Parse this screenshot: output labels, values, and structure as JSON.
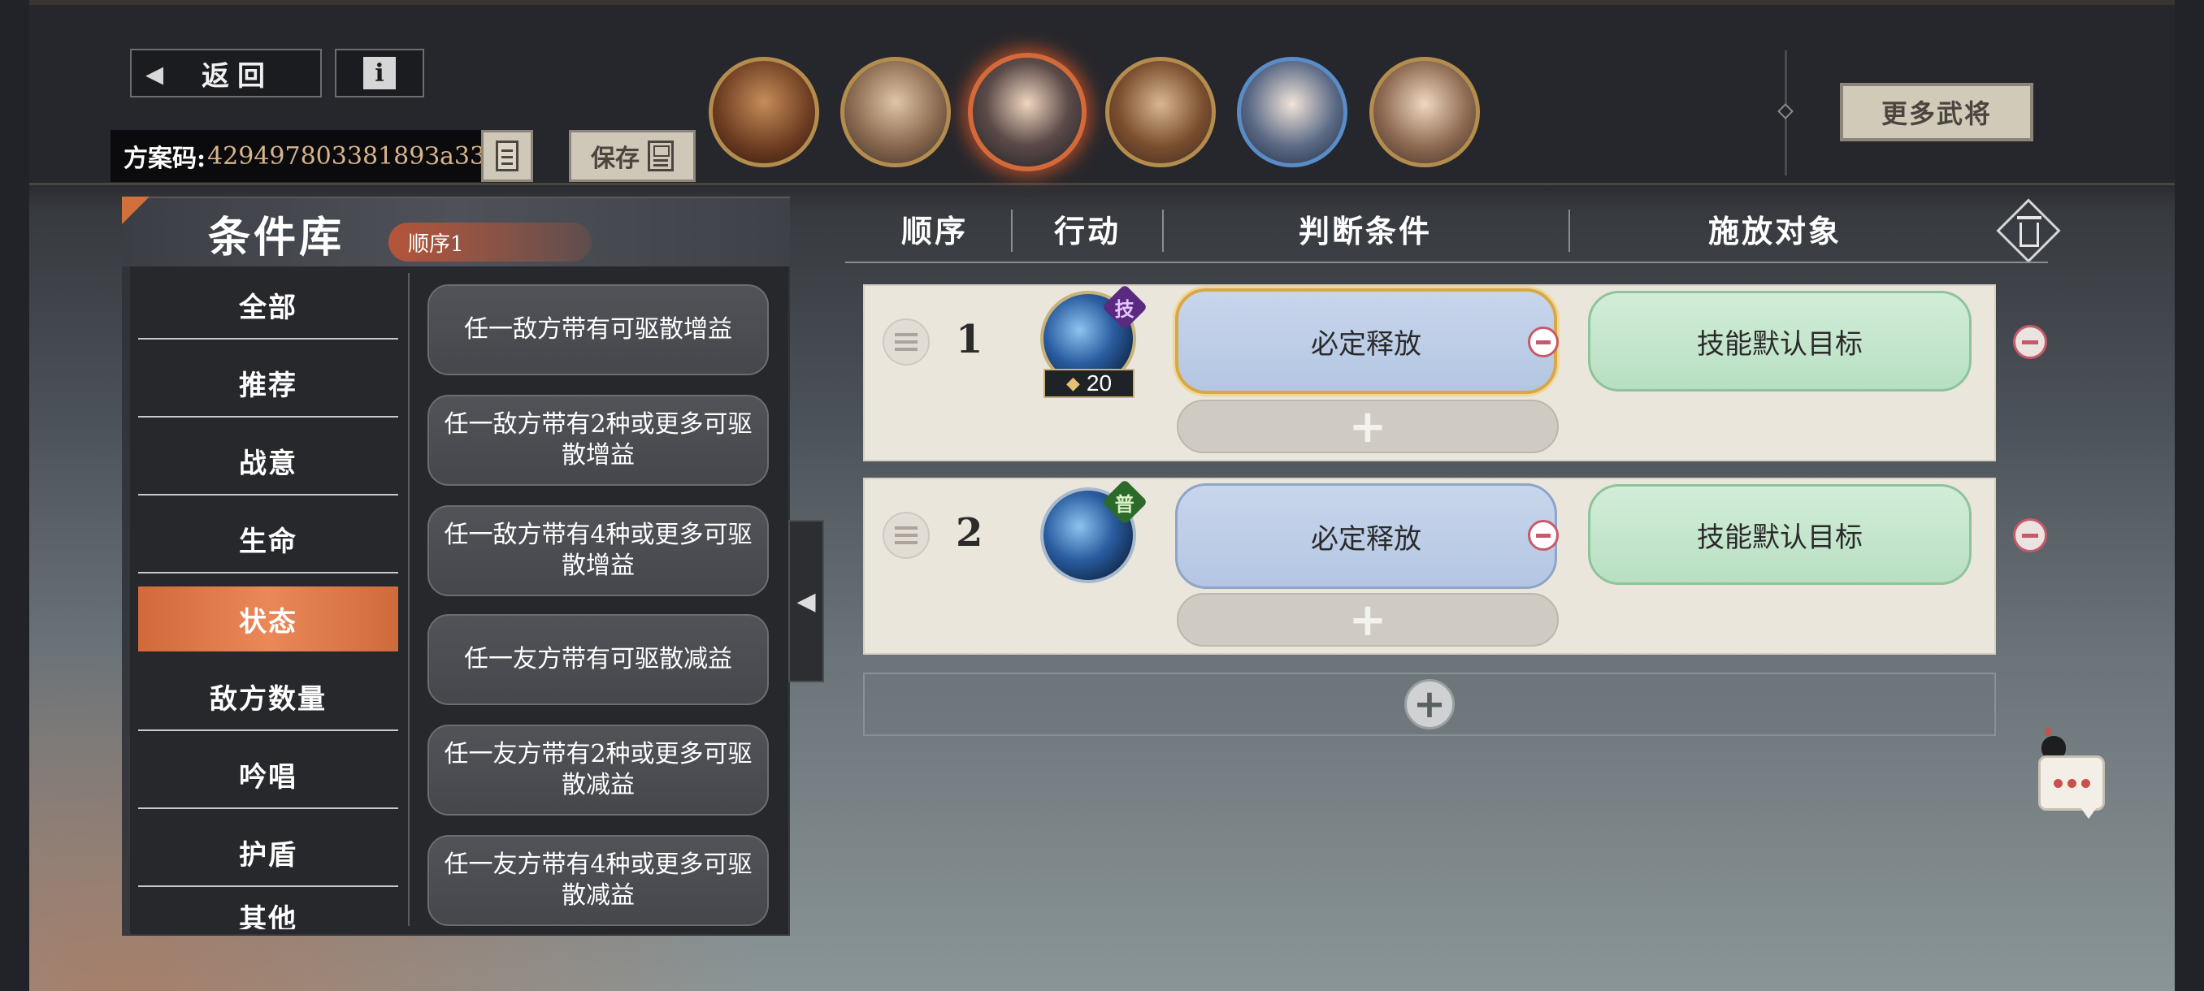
{
  "header": {
    "back_label": "返回",
    "info_icon": "i",
    "code_label": "方案码:",
    "code_value": "42949780338189За33",
    "save_label": "保存",
    "more_label": "更多武将"
  },
  "portraits": [
    {
      "name": "portrait-1",
      "state": "normal"
    },
    {
      "name": "portrait-2",
      "state": "normal"
    },
    {
      "name": "portrait-3",
      "state": "selected"
    },
    {
      "name": "portrait-4",
      "state": "normal"
    },
    {
      "name": "portrait-5",
      "state": "blue"
    },
    {
      "name": "portrait-6",
      "state": "normal"
    }
  ],
  "library": {
    "title": "条件库",
    "order_tag": "顺序1",
    "categories": [
      "全部",
      "推荐",
      "战意",
      "生命",
      "状态",
      "敌方数量",
      "吟唱",
      "护盾",
      "其他"
    ],
    "active_category": "状态",
    "conditions": [
      "任一敌方带有可驱散增益",
      "任一敌方带有2种或更多可驱散增益",
      "任一敌方带有4种或更多可驱散增益",
      "任一友方带有可驱散减益",
      "任一友方带有2种或更多可驱散减益",
      "任一友方带有4种或更多可驱散减益"
    ]
  },
  "table": {
    "headers": {
      "order": "顺序",
      "action": "行动",
      "condition": "判断条件",
      "target": "施放对象"
    },
    "rows": [
      {
        "num": "1",
        "tag": "技",
        "cost": "20",
        "condition": "必定释放",
        "target": "技能默认目标",
        "add": "+"
      },
      {
        "num": "2",
        "tag": "普",
        "condition": "必定释放",
        "target": "技能默认目标",
        "add": "+"
      }
    ]
  },
  "colors": {
    "accent_orange": "#e07a48",
    "cond_blue": "#bfcfe8",
    "target_green": "#c6e6cf",
    "minus_red": "#c8596b"
  }
}
